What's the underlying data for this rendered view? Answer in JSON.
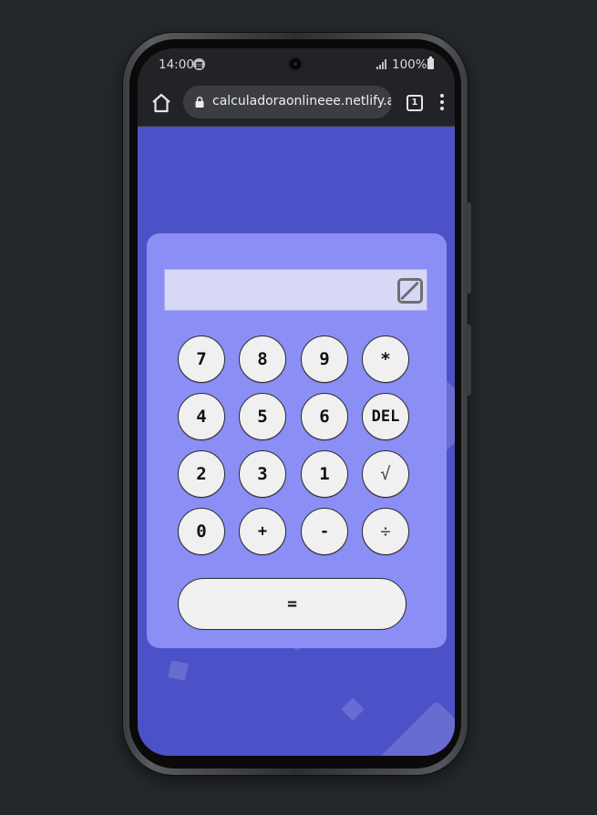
{
  "status_bar": {
    "time": "14:00",
    "battery": "100%",
    "app_icon": "spotify-icon"
  },
  "browser": {
    "url": "calculadoraonlineee.netlify.app",
    "tab_count": "1",
    "icons": {
      "home": "home-icon",
      "lock": "lock-icon",
      "menu": "more-vert-icon"
    }
  },
  "calculator": {
    "display_value": "",
    "clear_icon": "clear-display-icon",
    "keys": [
      [
        "7",
        "8",
        "9",
        "*"
      ],
      [
        "4",
        "5",
        "6",
        "DEL"
      ],
      [
        "2",
        "3",
        "1",
        "√"
      ],
      [
        "0",
        "+",
        "-",
        "÷"
      ]
    ],
    "equals_label": "="
  },
  "colors": {
    "page_background": "#4b52c7",
    "calculator_panel": "#8b8ff5",
    "display_background": "#d7d8f6",
    "key_background": "#f0f0f0"
  }
}
